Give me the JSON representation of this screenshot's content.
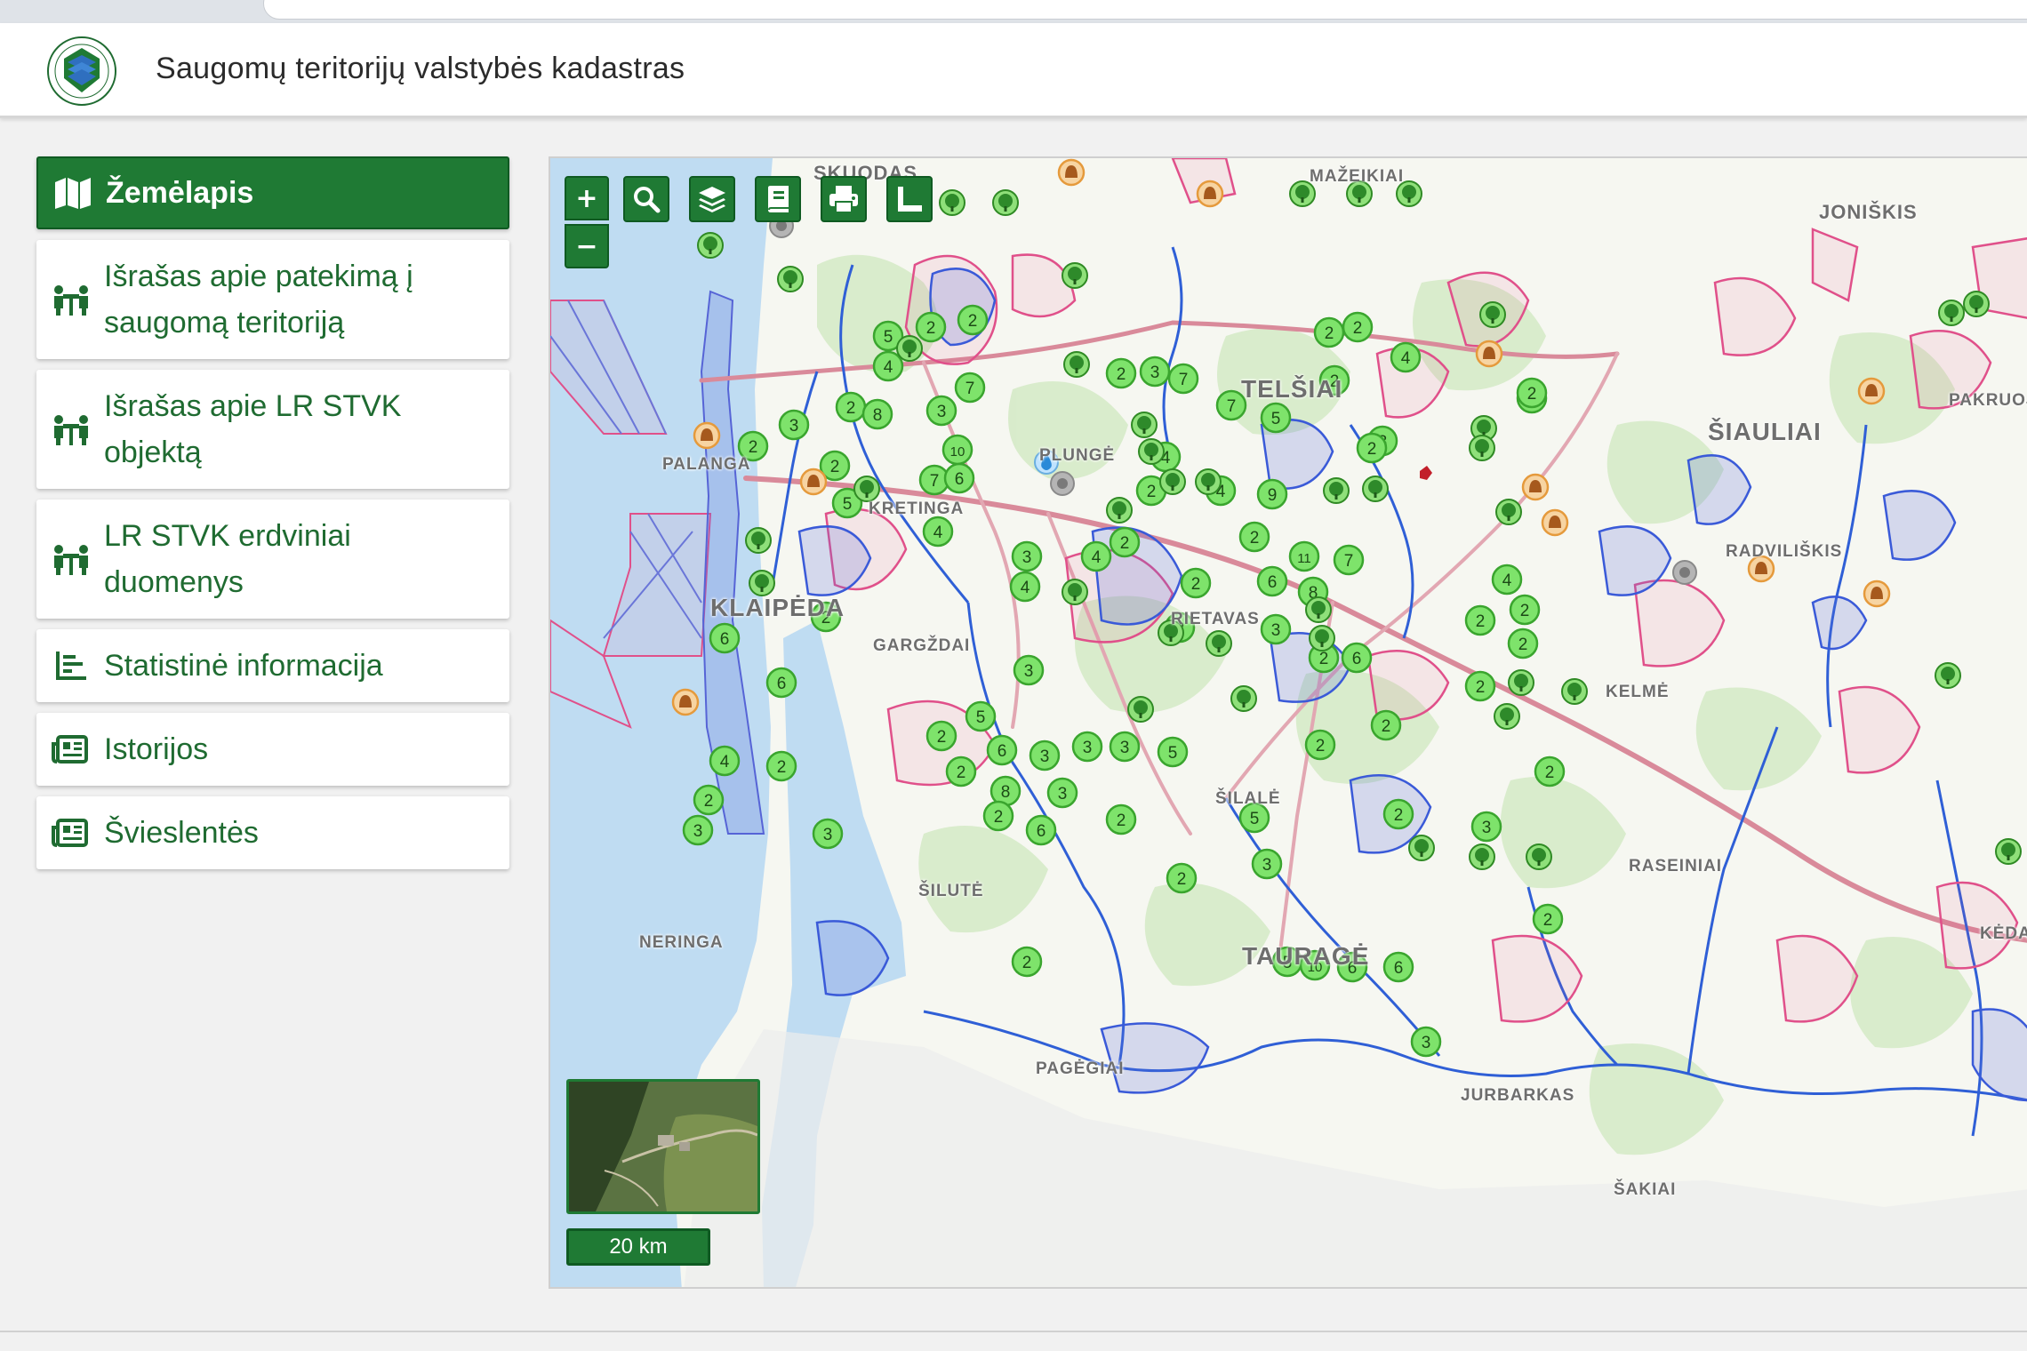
{
  "header": {
    "title": "Saugomų teritorijų valstybės kadastras"
  },
  "sidebar": {
    "items": [
      {
        "label": "Žemėlapis",
        "icon": "map-icon",
        "active": true
      },
      {
        "label": "Išrašas apie patekimą į saugomą teritoriją",
        "icon": "people-table-icon",
        "active": false
      },
      {
        "label": "Išrašas apie LR STVK objektą",
        "icon": "people-table-icon",
        "active": false
      },
      {
        "label": "LR STVK erdviniai duomenys",
        "icon": "people-table-icon",
        "active": false
      },
      {
        "label": "Statistinė informacija",
        "icon": "bar-chart-icon",
        "active": false
      },
      {
        "label": "Istorijos",
        "icon": "newspaper-icon",
        "active": false
      },
      {
        "label": "Švieslentės",
        "icon": "newspaper-icon",
        "active": false
      }
    ]
  },
  "map": {
    "controls": {
      "zoom_in": "+",
      "zoom_out": "−",
      "tools": [
        "search-icon",
        "layers-icon",
        "book-icon",
        "print-icon",
        "measure-icon"
      ]
    },
    "scale": "20 km",
    "places": [
      "SKUODAS",
      "JONIŠKIS",
      "TELŠIAI",
      "ŠIAULIAI",
      "PALANGA",
      "PLUNGĖ",
      "KRETINGA",
      "RADVILIŠKIS",
      "KLAIPĖDA",
      "RIETAVAS",
      "GARGŽDAI",
      "KELMĖ",
      "ŠILALĖ",
      "ŠILUTĖ",
      "RASEINIAI",
      "NERINGA",
      "TAURAGĖ",
      "PAGĖGIAI",
      "JURBARKAS",
      "ŠAKIAI",
      "MAŽEIKIAI",
      "PAKRUOJIS",
      "KĖDAINIAI"
    ],
    "colors": {
      "primary_green": "#1f7a34",
      "water": "#bfdcf2",
      "river": "#2f5fd6",
      "reserve_pink": "#e0508a",
      "cluster_green": "#7ee36b",
      "tree_marker": "#2e8a2a",
      "heritage_marker": "#e59a3c"
    }
  }
}
